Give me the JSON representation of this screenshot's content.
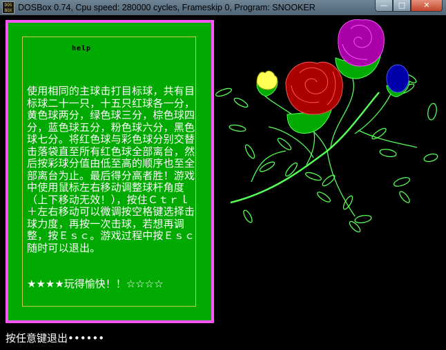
{
  "window": {
    "title": "DOSBox 0.74, Cpu speed:   280000 cycles, Frameskip  0, Program:  SNOOKER",
    "icon_text": "DOS BOX",
    "minimize_glyph": "—",
    "maximize_glyph": "□",
    "close_glyph": "✕"
  },
  "help": {
    "heading": "help",
    "body": "使用相同的主球击打目标球，共有目标球二十一只，十五只红球各一分，黄色球两分，绿色球三分，棕色球四分，蓝色球五分，粉色球六分，黑色球七分。将红色球与彩色球分别交替击落袋直至所有红色球全部离台，然后按彩球分值由低至高的顺序也至全部离台为止。最后得分高者胜！游戏中使用鼠标左右移动调整球杆角度（上下移动无效！），按住Ｃｔｒｌ＋左右移动可以微调按空格键选择击球力度，再按一次击球，若想再调整，按Ｅｓｃ。游戏过程中按Ｅｓｃ随时可以退出。",
    "stars_line": "★★★★玩得愉快！！☆☆☆☆"
  },
  "footer": {
    "exit_prompt": "按任意键退出••••••"
  },
  "colors": {
    "panel_border": "#ff55ff",
    "panel_bg": "#00aa00",
    "frame_line": "#cccc44",
    "rose_red": "#aa0000",
    "rose_magenta": "#aa00aa",
    "bud_blue": "#0000aa",
    "bud_yellow": "#ffff55",
    "stem_green": "#55ff55"
  },
  "icons": [
    "dosbox-logo-icon",
    "minimize-icon",
    "maximize-icon",
    "close-icon"
  ]
}
